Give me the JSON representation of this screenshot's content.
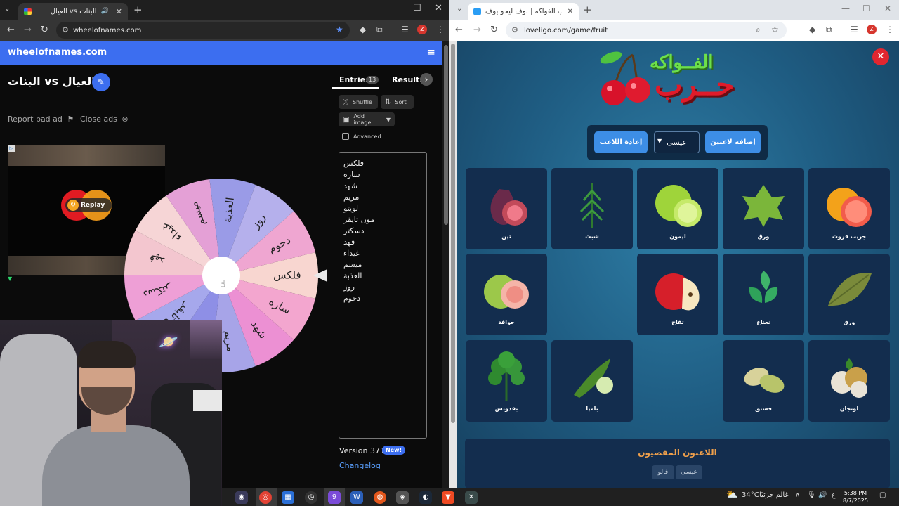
{
  "left_browser": {
    "tab_title": "العيال vs البنات",
    "url": "wheelofnames.com",
    "profile_letter": "Z"
  },
  "wheelofnames": {
    "brand": "wheelofnames.com",
    "wheel_title": "البنات vs العيال",
    "report_ad": "Report bad ad",
    "close_ads": "Close ads",
    "ad_replay": "Replay",
    "tabs": {
      "entries": "Entries",
      "entries_count": "13",
      "results": "Results"
    },
    "buttons": {
      "shuffle": "Shuffle",
      "sort": "Sort",
      "add_image": "Add image",
      "advanced": "Advanced"
    },
    "entries": [
      "فلكس",
      "ساره",
      "شهد",
      "مريم",
      "لويتو",
      "مون تايقر",
      "دسكتر",
      "فهد",
      "غيداء",
      "ميسم",
      "العذبة",
      "روز",
      "دحوم"
    ],
    "wheel_labels": [
      "فلكس",
      "ساره",
      "شهد",
      "مريم",
      "لويتو",
      "مون تايقر",
      "دسكتر",
      "فهد",
      "غيداء",
      "ميسم",
      "العذبة",
      "روز",
      "دحوم"
    ],
    "wheel_colors": [
      "#f8d6d0",
      "#f3a6cf",
      "#ec90d3",
      "#a7a4e8",
      "#8e8fe6",
      "#a6a8ec",
      "#ee9fd6",
      "#f3c6cf",
      "#f6d5d6",
      "#e4a0d6",
      "#9a9be7",
      "#b5b0ec",
      "#efa6d1"
    ],
    "version": "Version 371",
    "new_badge": "New!",
    "changelog": "Changelog"
  },
  "right_browser": {
    "tab_title": "لعبة حرب الفواكه | لوف ليجو يوف",
    "url": "loveligo.com/game/fruit",
    "profile_letter": "Z"
  },
  "game": {
    "logo_top": "الفــواكه",
    "logo_bottom": "حــرب",
    "add_players": "إضافة لاعبين",
    "player_select": "عيسى",
    "reset_player": "إعادة اللاعب",
    "cards": [
      {
        "label": "جريب فروت",
        "icon": "grapefruit-icon"
      },
      {
        "label": "ورق",
        "icon": "grape-leaf-icon"
      },
      {
        "label": "ليمون",
        "icon": "lime-icon"
      },
      {
        "label": "شبث",
        "icon": "dill-icon"
      },
      {
        "label": "تين",
        "icon": "fig-icon"
      },
      {
        "label": "ورق",
        "icon": "bay-leaf-icon"
      },
      {
        "label": "نعناع",
        "icon": "mint-icon"
      },
      {
        "label": "تفاح",
        "icon": "apple-icon"
      },
      {
        "label": "جوافة",
        "icon": "guava-icon"
      },
      {
        "label": "لونجان",
        "icon": "longan-icon"
      },
      {
        "label": "فستق",
        "icon": "pistachio-icon"
      },
      {
        "label": "باميا",
        "icon": "okra-icon"
      },
      {
        "label": "بقدونس",
        "icon": "parsley-icon"
      }
    ],
    "eliminated_title": "اللاعبون المقصيون",
    "eliminated": [
      "عيسى",
      "فالو"
    ]
  },
  "taskbar": {
    "weather_temp": "34°C",
    "weather_text": "غالم جزئيًا",
    "lang": "ع",
    "time": "5:38 PM",
    "date": "8/7/2025"
  }
}
